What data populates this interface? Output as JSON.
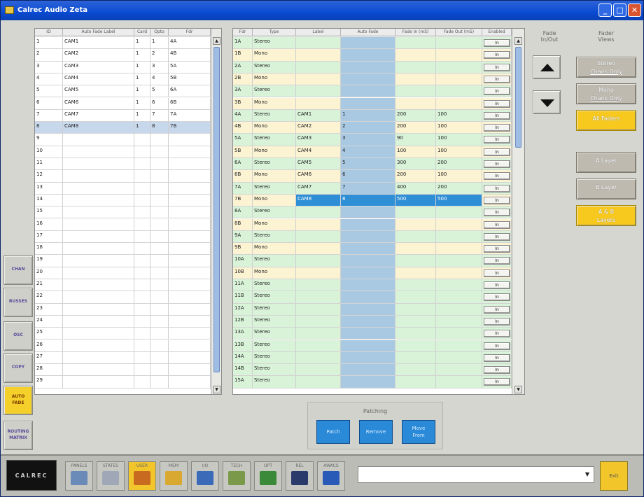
{
  "window": {
    "title": "Calrec Audio Zeta",
    "min": "_",
    "max": "□",
    "close": "✕"
  },
  "left_table": {
    "columns": [
      "ID",
      "Auto Fade Label",
      "Card",
      "Opto",
      "Fdr"
    ],
    "rows": [
      [
        "1",
        "CAM1",
        "1",
        "1",
        "4A"
      ],
      [
        "2",
        "CAM2",
        "1",
        "2",
        "4B"
      ],
      [
        "3",
        "CAM3",
        "1",
        "3",
        "5A"
      ],
      [
        "4",
        "CAM4",
        "1",
        "4",
        "5B"
      ],
      [
        "5",
        "CAM5",
        "1",
        "5",
        "6A"
      ],
      [
        "6",
        "CAM6",
        "1",
        "6",
        "6B"
      ],
      [
        "7",
        "CAM7",
        "1",
        "7",
        "7A"
      ],
      [
        "8",
        "CAM8",
        "1",
        "8",
        "7B"
      ],
      [
        "9",
        "",
        "",
        "",
        ""
      ],
      [
        "10",
        "",
        "",
        "",
        ""
      ],
      [
        "11",
        "",
        "",
        "",
        ""
      ],
      [
        "12",
        "",
        "",
        "",
        ""
      ],
      [
        "13",
        "",
        "",
        "",
        ""
      ],
      [
        "14",
        "",
        "",
        "",
        ""
      ],
      [
        "15",
        "",
        "",
        "",
        ""
      ],
      [
        "16",
        "",
        "",
        "",
        ""
      ],
      [
        "17",
        "",
        "",
        "",
        ""
      ],
      [
        "18",
        "",
        "",
        "",
        ""
      ],
      [
        "19",
        "",
        "",
        "",
        ""
      ],
      [
        "20",
        "",
        "",
        "",
        ""
      ],
      [
        "21",
        "",
        "",
        "",
        ""
      ],
      [
        "22",
        "",
        "",
        "",
        ""
      ],
      [
        "23",
        "",
        "",
        "",
        ""
      ],
      [
        "24",
        "",
        "",
        "",
        ""
      ],
      [
        "25",
        "",
        "",
        "",
        ""
      ],
      [
        "26",
        "",
        "",
        "",
        ""
      ],
      [
        "27",
        "",
        "",
        "",
        ""
      ],
      [
        "28",
        "",
        "",
        "",
        ""
      ],
      [
        "29",
        "",
        "",
        "",
        ""
      ]
    ],
    "selected_row": 7
  },
  "right_table": {
    "columns": [
      "Fdr",
      "Type",
      "Label",
      "Auto Fade",
      "Fade In (mS)",
      "Fade Out (mS)",
      "Enabled"
    ],
    "enabled_label": "In",
    "rows": [
      [
        "1A",
        "Stereo",
        "",
        "",
        "",
        ""
      ],
      [
        "1B",
        "Mono",
        "",
        "",
        "",
        ""
      ],
      [
        "2A",
        "Stereo",
        "",
        "",
        "",
        ""
      ],
      [
        "2B",
        "Mono",
        "",
        "",
        "",
        ""
      ],
      [
        "3A",
        "Stereo",
        "",
        "",
        "",
        ""
      ],
      [
        "3B",
        "Mono",
        "",
        "",
        "",
        ""
      ],
      [
        "4A",
        "Stereo",
        "CAM1",
        "1",
        "200",
        "100"
      ],
      [
        "4B",
        "Mono",
        "CAM2",
        "2",
        "200",
        "100"
      ],
      [
        "5A",
        "Stereo",
        "CAM3",
        "3",
        "90",
        "100"
      ],
      [
        "5B",
        "Mono",
        "CAM4",
        "4",
        "100",
        "100"
      ],
      [
        "6A",
        "Stereo",
        "CAM5",
        "5",
        "300",
        "200"
      ],
      [
        "6B",
        "Mono",
        "CAM6",
        "6",
        "200",
        "100"
      ],
      [
        "7A",
        "Stereo",
        "CAM7",
        "7",
        "400",
        "200"
      ],
      [
        "7B",
        "Mono",
        "CAM8",
        "8",
        "500",
        "500"
      ],
      [
        "8A",
        "Stereo",
        "",
        "",
        "",
        ""
      ],
      [
        "8B",
        "Mono",
        "",
        "",
        "",
        ""
      ],
      [
        "9A",
        "Stereo",
        "",
        "",
        "",
        ""
      ],
      [
        "9B",
        "Mono",
        "",
        "",
        "",
        ""
      ],
      [
        "10A",
        "Stereo",
        "",
        "",
        "",
        ""
      ],
      [
        "10B",
        "Mono",
        "",
        "",
        "",
        ""
      ],
      [
        "11A",
        "Stereo",
        "",
        "",
        "",
        ""
      ],
      [
        "11B",
        "Stereo",
        "",
        "",
        "",
        ""
      ],
      [
        "12A",
        "Stereo",
        "",
        "",
        "",
        ""
      ],
      [
        "12B",
        "Stereo",
        "",
        "",
        "",
        ""
      ],
      [
        "13A",
        "Stereo",
        "",
        "",
        "",
        ""
      ],
      [
        "13B",
        "Stereo",
        "",
        "",
        "",
        ""
      ],
      [
        "14A",
        "Stereo",
        "",
        "",
        "",
        ""
      ],
      [
        "14B",
        "Stereo",
        "",
        "",
        "",
        ""
      ],
      [
        "15A",
        "Stereo",
        "",
        "",
        "",
        ""
      ]
    ],
    "selected_row": 13
  },
  "fade_inout": {
    "label_line1": "Fade",
    "label_line2": "In/Out"
  },
  "fader_views": {
    "label_line1": "Fader",
    "label_line2": "Views",
    "stereo": [
      "Stereo",
      "Chans Only"
    ],
    "mono": [
      "Mono",
      "Chans Only"
    ],
    "all": "All Faders",
    "a_layer": "A Layer",
    "b_layer": "B Layer",
    "ab": [
      "A & B",
      "Layers"
    ]
  },
  "patching": {
    "title": "Patching",
    "patch": "Patch",
    "remove": "Remove",
    "move": [
      "Move",
      "From"
    ]
  },
  "side_buttons": [
    {
      "line1": "CHAN",
      "line2": ""
    },
    {
      "line1": "BUSSES",
      "line2": ""
    },
    {
      "line1": "OSC",
      "line2": ""
    },
    {
      "line1": "COPY",
      "line2": ""
    },
    {
      "line1": "AUTO",
      "line2": "FADE"
    },
    {
      "line1": "ROUTING",
      "line2": "MATRIX"
    }
  ],
  "bottom_bar": {
    "logo": "CALREC",
    "buttons": [
      "PANELS",
      "STATES",
      "USER",
      "MEM",
      "I/O",
      "TECH",
      "OPT",
      "REL",
      "AWACS"
    ],
    "active": "USER",
    "dropdown_value": "",
    "exit": "Exit"
  },
  "colors": {
    "stereo_row": "#d9f3d9",
    "mono_row": "#fbf3d2",
    "autofade_col": "#a9c9e3",
    "selected": "#2f8fd6",
    "active_button": "#f7c91e"
  }
}
